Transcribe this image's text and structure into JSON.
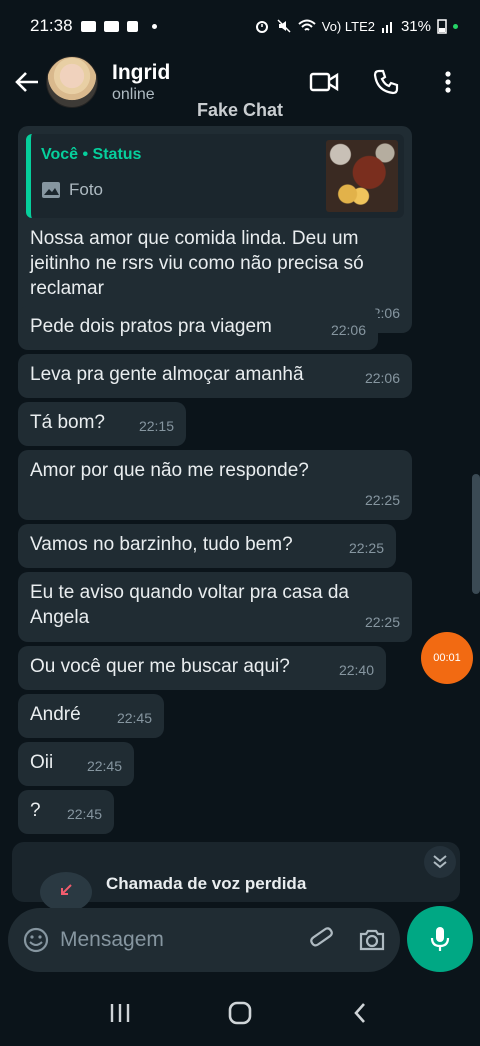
{
  "status_bar": {
    "time": "21:38",
    "battery": "31%",
    "network": "Vo) LTE2"
  },
  "header": {
    "contact_name": "Ingrid",
    "contact_status": "online"
  },
  "overlay_label": "Fake Chat",
  "reply": {
    "who": "Você • Status",
    "type": "Foto"
  },
  "messages": [
    {
      "text": "Nossa amor que comida linda. Deu um jeitinho ne rsrs viu como não precisa só reclamar",
      "time": "22:06"
    },
    {
      "text": "Pede dois pratos pra viagem",
      "time": "22:06"
    },
    {
      "text": "Leva pra gente almoçar amanhã",
      "time": "22:06"
    },
    {
      "text": "Tá bom?",
      "time": "22:15"
    },
    {
      "text": "Amor por que não me responde?",
      "time": "22:25"
    },
    {
      "text": "Vamos no barzinho, tudo bem?",
      "time": "22:25"
    },
    {
      "text": "Eu te aviso quando voltar pra casa da Angela",
      "time": "22:25"
    },
    {
      "text": "Ou você quer me buscar aqui?",
      "time": "22:40"
    },
    {
      "text": "André",
      "time": "22:45"
    },
    {
      "text": "Oii",
      "time": "22:45"
    },
    {
      "text": "?",
      "time": "22:45"
    }
  ],
  "recording_badge": "00:01",
  "missed_call": "Chamada de voz perdida",
  "composer": {
    "placeholder": "Mensagem"
  },
  "colors": {
    "background": "#0b141a",
    "bubble": "#202c33",
    "accent": "#00a884",
    "reply_accent": "#06cf9c",
    "record": "#f26a12"
  }
}
